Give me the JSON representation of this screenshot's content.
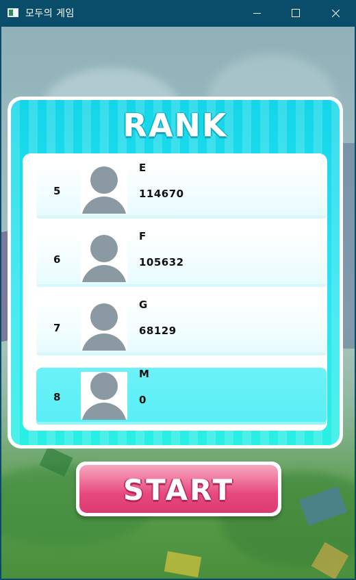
{
  "window": {
    "title": "모두의 게임"
  },
  "panel": {
    "title": "RANK"
  },
  "rankings": [
    {
      "rank": "5",
      "name": "E",
      "score": "114670",
      "highlight": false
    },
    {
      "rank": "6",
      "name": "F",
      "score": "105632",
      "highlight": false
    },
    {
      "rank": "7",
      "name": "G",
      "score": "68129",
      "highlight": false
    },
    {
      "rank": "8",
      "name": "M",
      "score": "0",
      "highlight": true
    }
  ],
  "start_button": {
    "label": "START"
  },
  "icons": {
    "avatar": "default-user-avatar-icon",
    "minimize": "minimize-icon",
    "maximize": "maximize-icon",
    "close": "close-icon"
  },
  "colors": {
    "titlebar": "#0a4d6b",
    "panel": "#14d6e8",
    "highlight_row": "#5ff0f6",
    "start_button": "#e6497e"
  }
}
